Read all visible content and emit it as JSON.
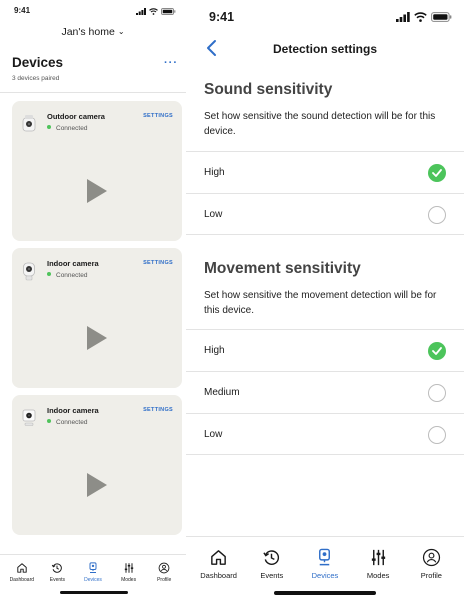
{
  "left_screen": {
    "status_time": "9:41",
    "home_label": "Jan's home",
    "devices_title": "Devices",
    "devices_subtitle": "3 devices paired",
    "more_glyph": "···",
    "cards": [
      {
        "name": "Outdoor camera",
        "status": "Connected",
        "settings_label": "SETTINGS",
        "icon": "outdoor-camera-icon"
      },
      {
        "name": "Indoor camera",
        "status": "Connected",
        "settings_label": "SETTINGS",
        "icon": "indoor-camera-icon"
      },
      {
        "name": "Indoor camera",
        "status": "Connected",
        "settings_label": "SETTINGS",
        "icon": "indoor-camera-icon"
      }
    ],
    "tabs": [
      {
        "label": "Dashboard",
        "icon": "home-icon",
        "active": false
      },
      {
        "label": "Events",
        "icon": "history-icon",
        "active": false
      },
      {
        "label": "Devices",
        "icon": "camera-icon",
        "active": true
      },
      {
        "label": "Modes",
        "icon": "sliders-icon",
        "active": false
      },
      {
        "label": "Profile",
        "icon": "profile-icon",
        "active": false
      }
    ]
  },
  "right_screen": {
    "status_time": "9:41",
    "nav_title": "Detection settings",
    "sound": {
      "title": "Sound sensitivity",
      "description": "Set how sensitive the sound detection will be for this device.",
      "options": [
        {
          "label": "High",
          "selected": true
        },
        {
          "label": "Low",
          "selected": false
        }
      ]
    },
    "movement": {
      "title": "Movement sensitivity",
      "description": "Set how sensitive the movement detection will be for this device.",
      "options": [
        {
          "label": "High",
          "selected": true
        },
        {
          "label": "Medium",
          "selected": false
        },
        {
          "label": "Low",
          "selected": false
        }
      ]
    },
    "tabs": [
      {
        "label": "Dashboard",
        "icon": "home-icon",
        "active": false
      },
      {
        "label": "Events",
        "icon": "history-icon",
        "active": false
      },
      {
        "label": "Devices",
        "icon": "camera-icon",
        "active": true
      },
      {
        "label": "Modes",
        "icon": "sliders-icon",
        "active": false
      },
      {
        "label": "Profile",
        "icon": "profile-icon",
        "active": false
      }
    ]
  },
  "colors": {
    "accent": "#2f6ec8",
    "selected_green": "#4cc45b",
    "connected_green": "#4fc35b",
    "card_bg": "#efeee9"
  }
}
